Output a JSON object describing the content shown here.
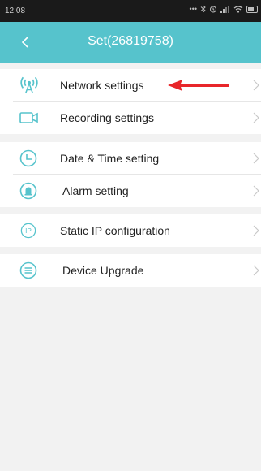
{
  "status_bar": {
    "time": "12:08"
  },
  "header": {
    "title": "Set(26819758)",
    "back_icon": "chevron-left-icon"
  },
  "groups": [
    {
      "items": [
        {
          "label": "Network settings",
          "icon": "antenna-icon"
        },
        {
          "label": "Recording settings",
          "icon": "video-camera-icon"
        }
      ]
    },
    {
      "items": [
        {
          "label": "Date & Time setting",
          "icon": "clock-icon"
        },
        {
          "label": "Alarm setting",
          "icon": "alarm-bell-icon"
        }
      ]
    },
    {
      "items": [
        {
          "label": "Static IP configuration",
          "icon": "ip-icon"
        }
      ]
    },
    {
      "items": [
        {
          "label": "Device Upgrade",
          "icon": "upgrade-menu-icon"
        }
      ]
    }
  ],
  "colors": {
    "accent": "#56c3cc",
    "annotation_arrow": "#e8262a",
    "background": "#f2f2f2"
  }
}
